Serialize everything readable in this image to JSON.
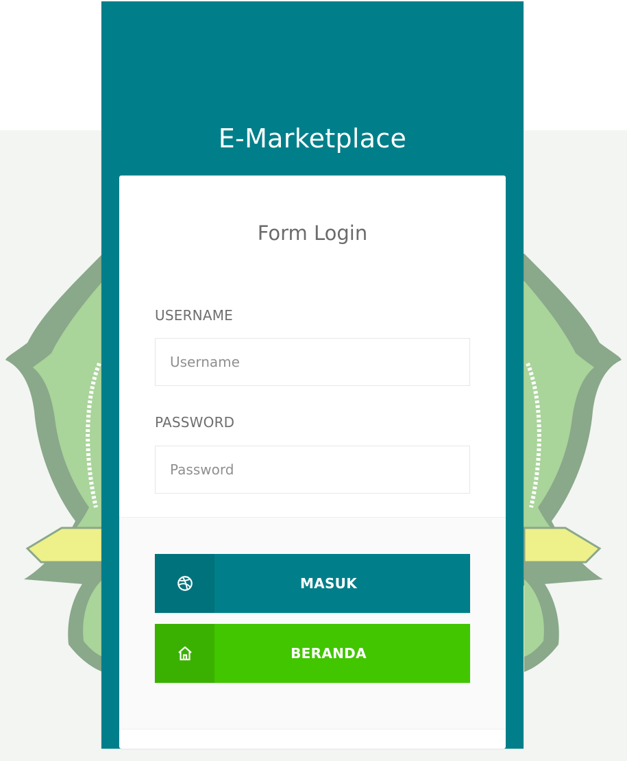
{
  "app": {
    "title": "E-Marketplace"
  },
  "form": {
    "title": "Form Login",
    "username": {
      "label": "USERNAME",
      "placeholder": "Username",
      "value": ""
    },
    "password": {
      "label": "PASSWORD",
      "placeholder": "Password",
      "value": ""
    }
  },
  "buttons": {
    "masuk": {
      "label": "MASUK",
      "icon": "dribbble-icon"
    },
    "beranda": {
      "label": "BERANDA",
      "icon": "home-icon"
    }
  },
  "colors": {
    "primary": "#007f8a",
    "primary_dark": "#00727c",
    "success": "#41c600",
    "success_dark": "#3ab100",
    "emblem_green": "#a9d49a",
    "emblem_outline": "#8aa88a",
    "emblem_yellow": "#eef08a"
  }
}
